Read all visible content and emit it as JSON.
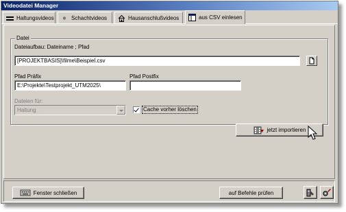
{
  "window": {
    "title": "Videodatei Manager"
  },
  "tabs": [
    {
      "label": "Haltungsvideos",
      "icon": "lines-icon"
    },
    {
      "label": "Schachtvideos",
      "icon": "dot-icon"
    },
    {
      "label": "Hausanschlußvideos",
      "icon": "house-icon"
    },
    {
      "label": "aus CSV einlesen",
      "icon": "table-icon",
      "active": true
    }
  ],
  "group": {
    "title": "Datei",
    "structure_label": "Dateiaufbau: Dateiname ; Pfad",
    "file_path": "[PROJEKTBASIS]\\filme\\Beispiel.csv",
    "prefix_label": "Pfad Präfix",
    "prefix_value": "E:\\Projekte\\Testprojekt_UTM2025\\",
    "postfix_label": "Pfad Postfix",
    "postfix_value": "",
    "files_for_label": "Dateien für:",
    "files_for_value": "Haltung",
    "clear_cache_label": "Cache vorher löschen",
    "clear_cache_checked": true
  },
  "actions": {
    "import_label": "jetzt importieren"
  },
  "footer": {
    "close_label": "Fenster schließen",
    "check_label": "auf Befehle prüfen"
  },
  "colors": {
    "face": "#d4d0c8",
    "title_start": "#0a246a",
    "title_end": "#a6caf0"
  }
}
